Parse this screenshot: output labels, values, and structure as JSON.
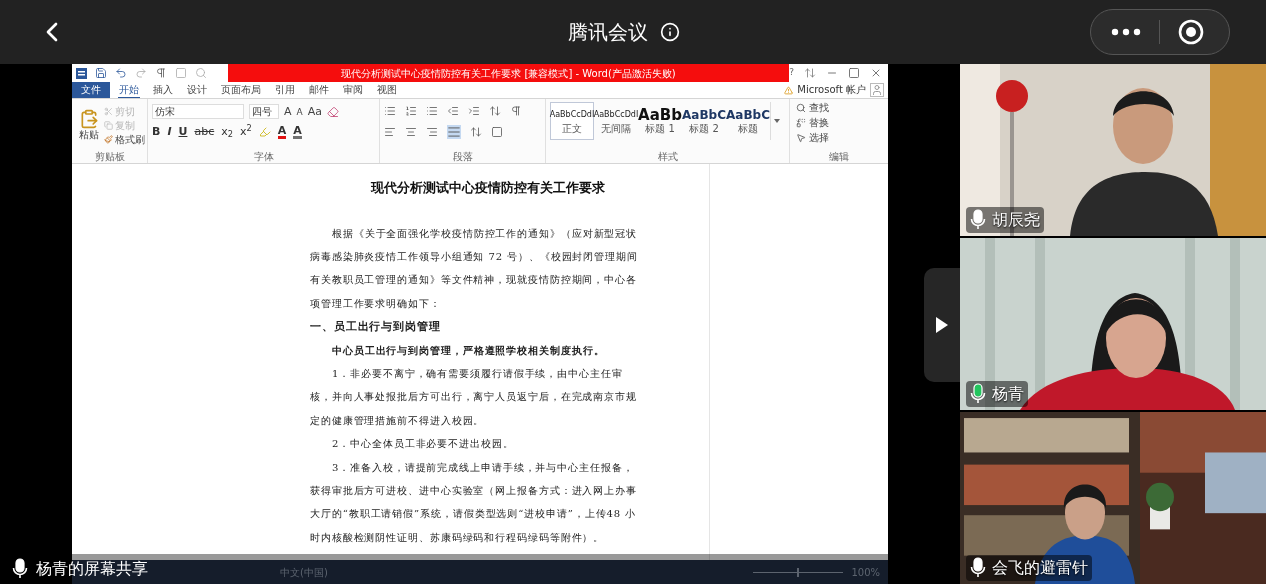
{
  "meeting": {
    "title": "腾讯会议",
    "share_label": "杨青的屏幕共享"
  },
  "word": {
    "title": "现代分析测试中心疫情防控有关工作要求 [兼容模式] - Word(产品激活失败)",
    "help": "?",
    "account": "Microsoft 帐户",
    "file_tab": "文件",
    "tabs": [
      {
        "label": "开始",
        "selected": true
      },
      {
        "label": "插入",
        "selected": false
      },
      {
        "label": "设计",
        "selected": false
      },
      {
        "label": "页面布局",
        "selected": false
      },
      {
        "label": "引用",
        "selected": false
      },
      {
        "label": "邮件",
        "selected": false
      },
      {
        "label": "审阅",
        "selected": false
      },
      {
        "label": "视图",
        "selected": false
      }
    ],
    "clipboard": {
      "paste": "粘贴",
      "label": "剪贴板",
      "items": [
        {
          "label": "剪切",
          "kind": "cut",
          "disabled": true
        },
        {
          "label": "复制",
          "kind": "copy",
          "disabled": true
        },
        {
          "label": "格式刷",
          "kind": "painter",
          "disabled": false
        }
      ]
    },
    "font": {
      "name": "仿宋",
      "size": "四号",
      "label": "字体",
      "tools": [
        {
          "label": "A",
          "kind": "grow"
        },
        {
          "label": "A",
          "kind": "shrink"
        },
        {
          "label": "Aa",
          "kind": "case"
        }
      ],
      "format_buttons": [
        {
          "label": "B",
          "kind": "bold"
        },
        {
          "label": "I",
          "kind": "italic"
        },
        {
          "label": "U",
          "kind": "underline"
        },
        {
          "label": "abc",
          "kind": "strike"
        },
        {
          "label": "x$_{2}$",
          "kind": "plain"
        },
        {
          "label": "x$^{2}$",
          "kind": "plain"
        }
      ],
      "color_buttons": [
        {
          "label": "A",
          "color": "#e01010"
        },
        {
          "label": "A",
          "color": "#707070"
        }
      ]
    },
    "paragraph": {
      "label": "段落"
    },
    "styles": {
      "label": "样式",
      "items": [
        {
          "preview": "AaBbCcDdI",
          "name": "正文",
          "kind": "body",
          "selected": true
        },
        {
          "preview": "AaBbCcDdI",
          "name": "无间隔",
          "kind": "body",
          "selected": false
        },
        {
          "preview": "AaBb",
          "name": "标题 1",
          "kind": "h1",
          "selected": false
        },
        {
          "preview": "AaBbC",
          "name": "标题 2",
          "kind": "h2",
          "selected": false
        },
        {
          "preview": "AaBbC",
          "name": "标题",
          "kind": "h2",
          "selected": false
        }
      ]
    },
    "editing": {
      "label": "编辑",
      "items": [
        {
          "label": "查找",
          "kind": "find"
        },
        {
          "label": "替换",
          "kind": "replace"
        },
        {
          "label": "选择",
          "kind": "select"
        }
      ]
    },
    "document": {
      "title": "现代分析测试中心疫情防控有关工作要求",
      "paragraphs": [
        {
          "kind": "body",
          "text": "根据《关于全面强化学校疫情防控工作的通知》（应对新型冠状病毒感染肺炎疫情工作领导小组通知 72 号）、《校园封闭管理期间有关教职员工管理的通知》等文件精神，现就疫情防控期间，中心各项管理工作要求明确如下："
        },
        {
          "kind": "heading",
          "text": "一、员工出行与到岗管理"
        },
        {
          "kind": "lead",
          "text": "中心员工出行与到岗管理，严格遵照学校相关制度执行。"
        },
        {
          "kind": "body",
          "text": "1．非必要不离宁，确有需要须履行请假手续，由中心主任审核，并向人事处报批后方可出行，离宁人员返宁后，在完成南京市规定的健康管理措施前不得进入校园。"
        },
        {
          "kind": "body",
          "text": "2．中心全体员工非必要不进出校园。"
        },
        {
          "kind": "body",
          "text": "3．准备入校，请提前完成线上申请手续，并与中心主任报备，获得审批后方可进校、进中心实验室（网上报备方式：进入网上办事大厅的“教职工请销假”系统，请假类型选则“进校申请”，上传48 小时内核酸检测阴性证明、苏康码绿码和行程码绿码等附件）。"
        }
      ]
    },
    "status_bar": {
      "language": "中文(中国)",
      "zoom": "100%"
    }
  },
  "participants": [
    {
      "name": "胡辰尧",
      "speaking": false,
      "kind": "man"
    },
    {
      "name": "杨青",
      "speaking": true,
      "kind": "woman"
    },
    {
      "name": "会飞的避雷针",
      "speaking": false,
      "kind": "library"
    }
  ]
}
